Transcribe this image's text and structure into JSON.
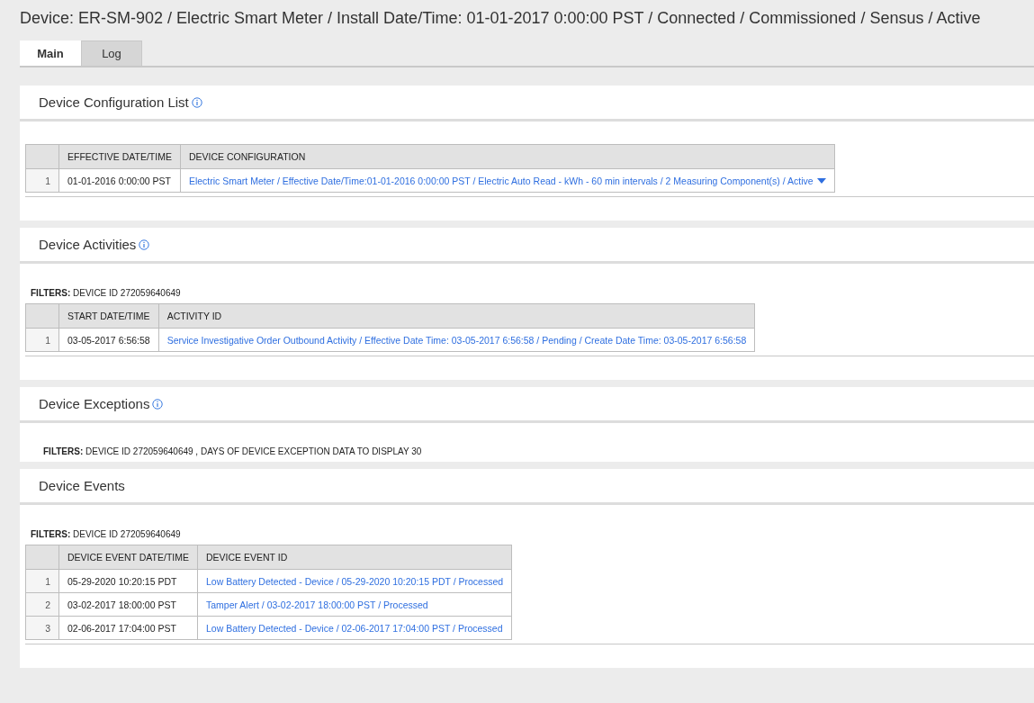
{
  "page_title": "Device: ER-SM-902 / Electric Smart Meter / Install Date/Time: 01-01-2017 0:00:00 PST / Connected / Commissioned / Sensus / Active",
  "tabs": [
    {
      "label": "Main",
      "selected": true
    },
    {
      "label": "Log",
      "selected": false
    }
  ],
  "sections": [
    {
      "title": "Device Configuration List",
      "has_info": true,
      "table": {
        "columns": [
          "EFFECTIVE DATE/TIME",
          "DEVICE CONFIGURATION"
        ],
        "rows": [
          {
            "number": "1",
            "cells": [
              "01-01-2016 0:00:00 PST",
              "Electric Smart Meter / Effective Date/Time:01-01-2016 0:00:00 PST / Electric Auto Read - kWh - 60 min intervals / 2 Measuring Component(s) / Active"
            ],
            "has_menu": true
          }
        ]
      }
    },
    {
      "title": "Device Activities",
      "has_info": true,
      "filters": "**FILTERS:** DEVICE ID 272059640649",
      "table": {
        "columns": [
          "START DATE/TIME",
          "ACTIVITY ID"
        ],
        "rows": [
          {
            "number": "1",
            "cells": [
              "03-05-2017 6:56:58",
              "Service Investigative Order Outbound Activity / Effective Date Time: 03-05-2017 6:56:58 / Pending / Create Date Time: 03-05-2017 6:56:58"
            ],
            "has_menu": false
          }
        ]
      }
    },
    {
      "title": "Device Exceptions",
      "has_info": true,
      "filters": "**FILTERS:** DEVICE ID 272059640649 , DAYS OF DEVICE EXCEPTION DATA TO DISPLAY 30",
      "filters_indented": true
    },
    {
      "title": "Device Events",
      "has_info": false,
      "filters": "**FILTERS:** DEVICE ID 272059640649",
      "table": {
        "columns": [
          "DEVICE EVENT DATE/TIME",
          "DEVICE EVENT ID"
        ],
        "rows": [
          {
            "number": "1",
            "cells": [
              "05-29-2020 10:20:15 PDT",
              "Low Battery Detected - Device / 05-29-2020 10:20:15 PDT / Processed"
            ],
            "has_menu": false
          },
          {
            "number": "2",
            "cells": [
              "03-02-2017 18:00:00 PST",
              "Tamper Alert / 03-02-2017 18:00:00 PST / Processed"
            ],
            "has_menu": false
          },
          {
            "number": "3",
            "cells": [
              "02-06-2017 17:04:00 PST",
              "Low Battery Detected - Device / 02-06-2017 17:04:00 PST / Processed"
            ],
            "has_menu": false
          }
        ]
      }
    }
  ]
}
